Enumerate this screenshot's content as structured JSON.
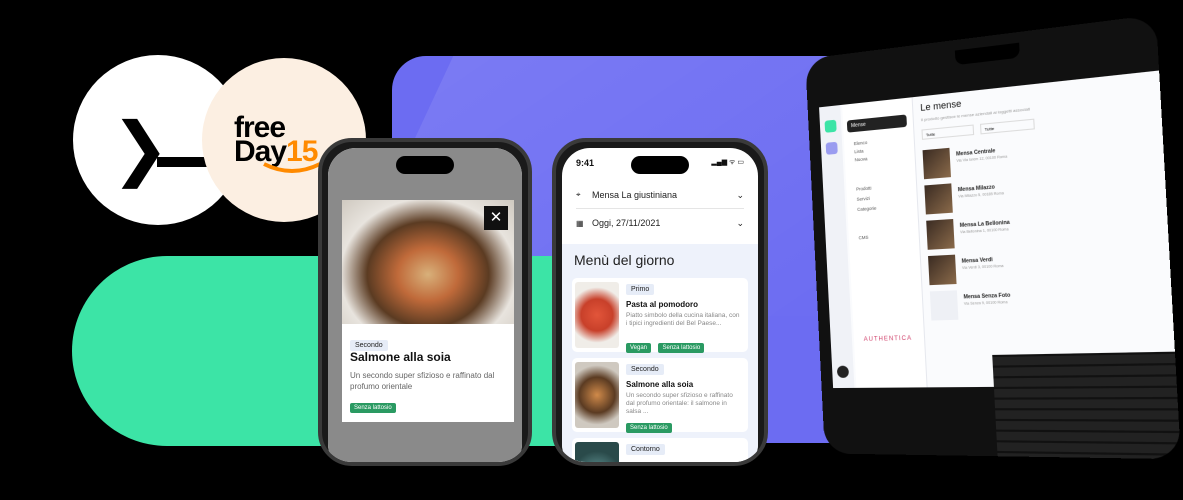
{
  "logos": {
    "prompt_symbol": "❯",
    "freeday_text_1": "free",
    "freeday_text_2": "Day",
    "freeday_text_3": "15"
  },
  "phone_left": {
    "close_symbol": "✕",
    "category": "Secondo",
    "dish_title": "Salmone alla soia",
    "dish_desc": "Un secondo super sfizioso e raffinato dal profumo orientale",
    "tag": "Senza lattosio"
  },
  "phone_mid": {
    "time": "9:41",
    "status_icons": "▂▄▆ ᯤ ▭",
    "canteen": "Mensa La giustiniana",
    "date": "Oggi, 27/11/2021",
    "menu_title": "Menù del giorno",
    "cards": [
      {
        "category": "Primo",
        "title": "Pasta al pomodoro",
        "desc": "Piatto simbolo della cucina italiana, con i tipici ingredienti del Bel Paese...",
        "tags": [
          "Vegan",
          "Senza lattosio"
        ]
      },
      {
        "category": "Secondo",
        "title": "Salmone alla soia",
        "desc": "Un secondo super sfizioso e raffinato dal profumo orientale: il salmone in salsa ...",
        "tags": [
          "Senza lattosio"
        ]
      },
      {
        "category": "Contorno",
        "title": "",
        "desc": "",
        "tags": []
      }
    ]
  },
  "laptop": {
    "page_title": "Le mense",
    "page_subtitle": "Il prodotto gestisce le mense aziendali ai loggetti associati",
    "nav_header": "Mense",
    "nav_items": [
      "Mense",
      "Elenco",
      "Lista",
      "Nuova"
    ],
    "nav_section2": [
      "Prodotti",
      "Servizi",
      "Categorie"
    ],
    "nav_section3": [
      "CMS"
    ],
    "filter_1": "Tutte",
    "filter_2": "Tutte",
    "rows": [
      {
        "name": "Mensa Centrale",
        "sub": "Via Via lorem 12, 00100 Roma"
      },
      {
        "name": "Mensa Milazzo",
        "sub": "Via Milazzo 5, 00185 Roma"
      },
      {
        "name": "Mensa La Bellonina",
        "sub": "Via Bellonina 1, 00100 Roma"
      },
      {
        "name": "Mensa Verdi",
        "sub": "Via Verdi 3, 00100 Roma"
      },
      {
        "name": "Mensa Senza Foto",
        "sub": "Via Senza 9, 00100 Roma"
      }
    ],
    "brand": "AUTHENTICA"
  }
}
